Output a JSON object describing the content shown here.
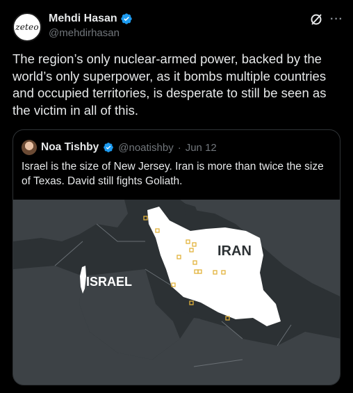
{
  "author": {
    "avatar_text": "zeteo",
    "name": "Mehdi Hasan",
    "handle": "@mehdirhasan"
  },
  "post": {
    "text": "The region’s only nuclear-armed power, backed by the world’s only superpower, as it bombs multiple countries and occupied territories, is desperate to still be seen as the victim in all of this."
  },
  "header_icons": [
    "grok-icon",
    "more-icon"
  ],
  "more_label": "···",
  "quote": {
    "name": "Noa Tishby",
    "handle": "@noatishby",
    "separator": "·",
    "date": "Jun 12",
    "text": "Israel is the size of New Jersey. Iran is more than twice the size of Texas. David still fights Goliath.",
    "map_labels": {
      "iran": "IRAN",
      "israel": "ISRAEL"
    }
  },
  "colors": {
    "verified": "#1d9bf0",
    "background": "#000000",
    "map_water": "#2c3134",
    "map_land": "#3d4246",
    "highlight_land": "#ffffff",
    "site_marker": "#e2b23a"
  }
}
